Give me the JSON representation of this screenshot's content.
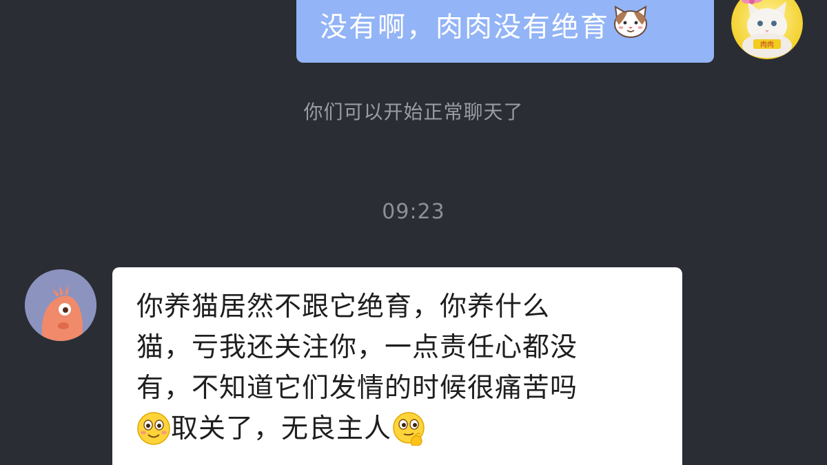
{
  "outgoing_message": {
    "text": "没有啊，肉肉没有绝育",
    "emoji": "cat-face-emoji"
  },
  "my_avatar": {
    "icon": "white-cat-with-bow-avatar",
    "caption": "肉肉"
  },
  "system_notice": "你们可以开始正常聊天了",
  "timestamp": "09:23",
  "their_avatar": {
    "icon": "orange-bird-avatar"
  },
  "incoming_message": {
    "lines": [
      "你养猫居然不跟它绝育，你养什么",
      "猫，亏我还关注你，一点责任心都没",
      "有，不知道它们发情的时候很痛苦吗",
      "取关了，无良主人"
    ],
    "emoji_1": "smiling-face-emoji",
    "emoji_2": "thinking-face-emoji"
  },
  "colors": {
    "background": "#2b2d34",
    "outgoing_bubble": "#93b4f6",
    "incoming_bubble": "#ffffff"
  }
}
